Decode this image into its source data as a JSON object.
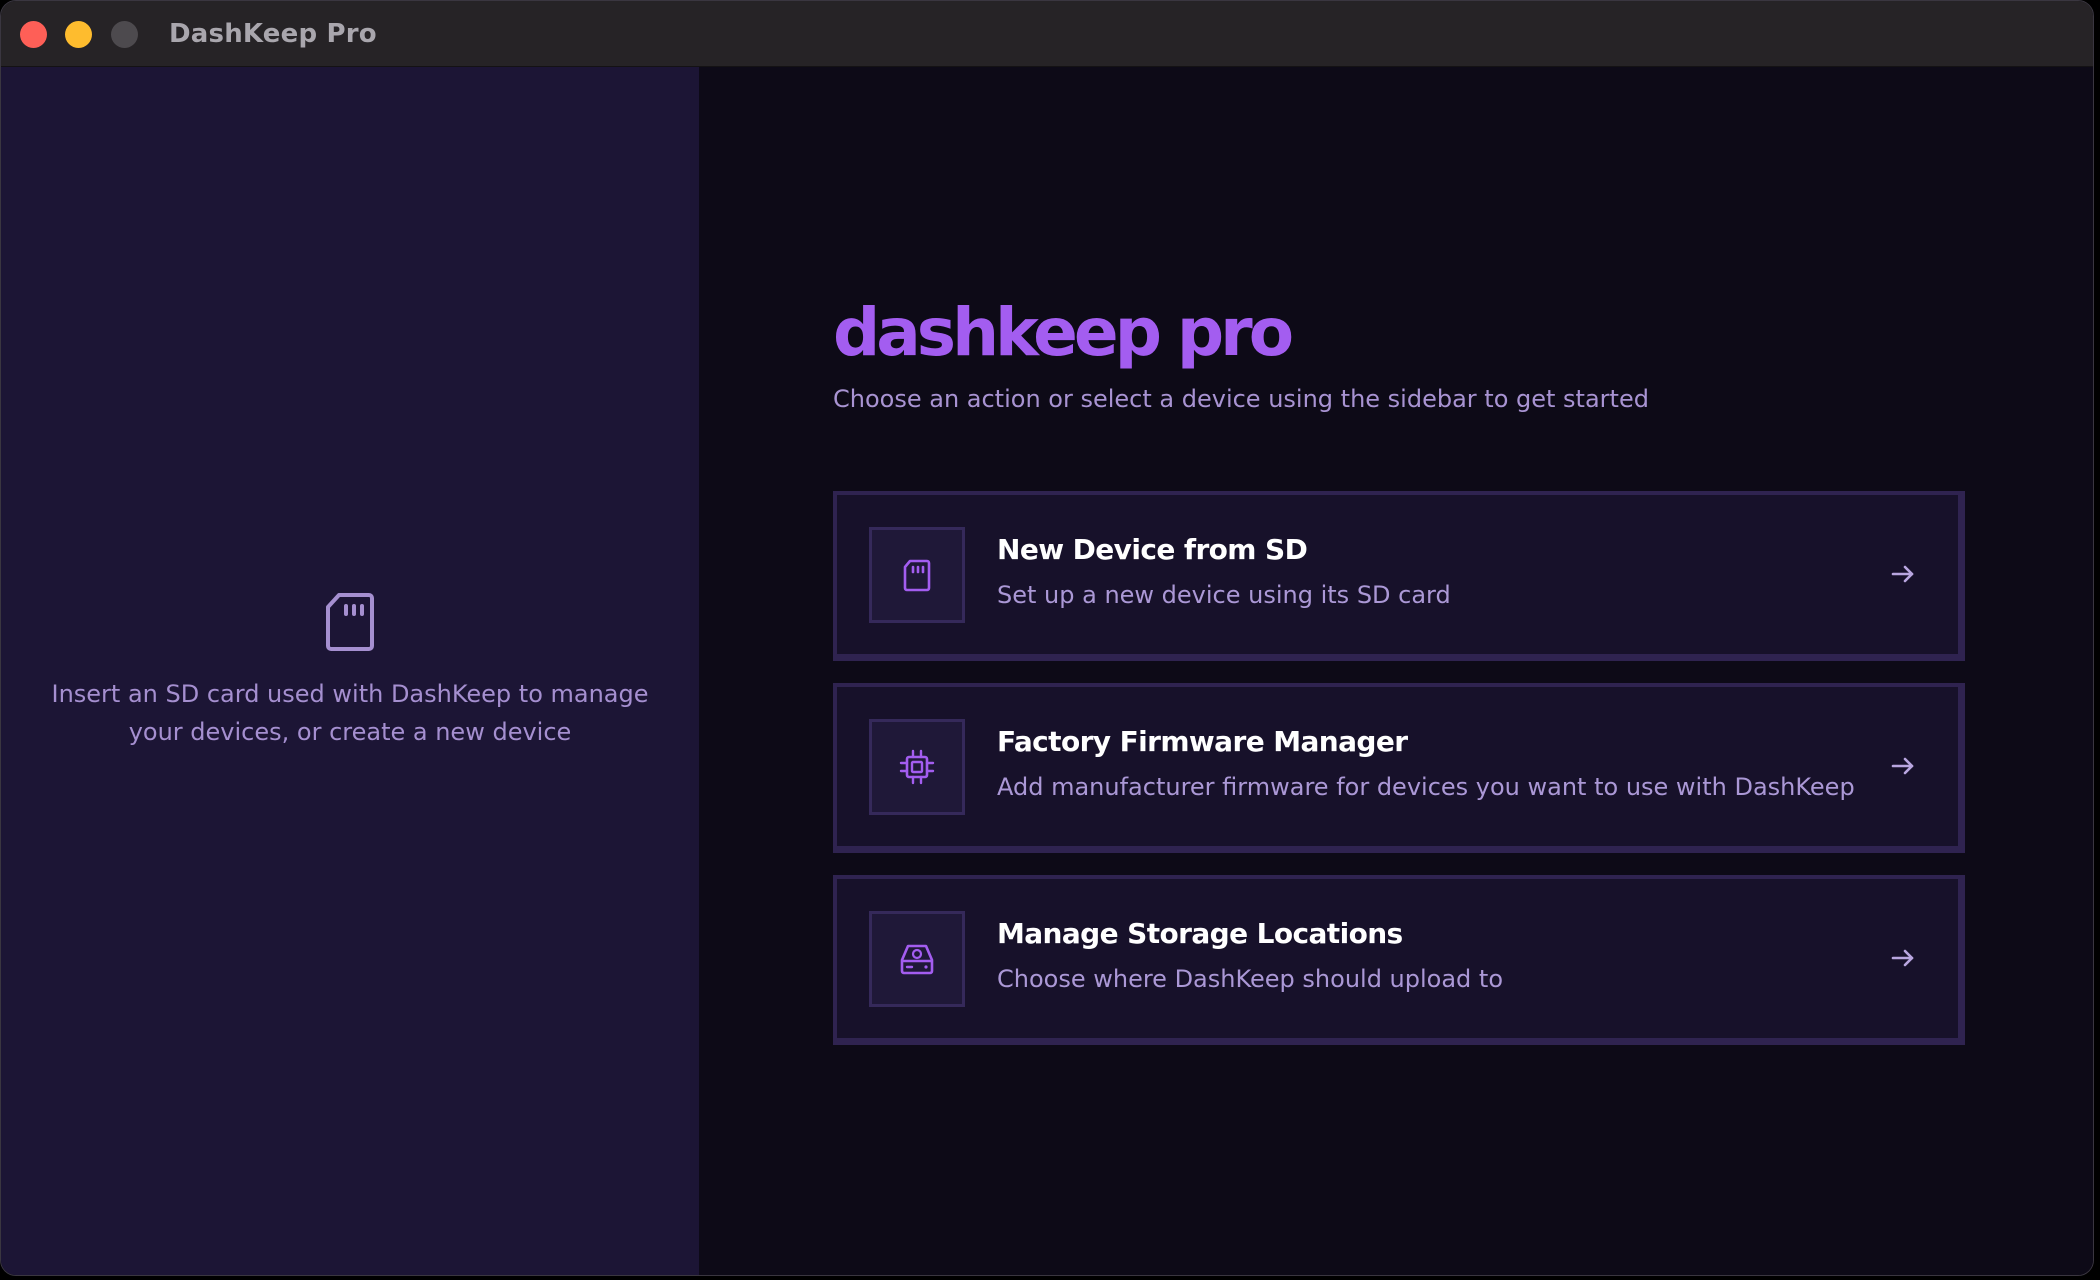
{
  "window": {
    "title": "DashKeep Pro"
  },
  "sidebar": {
    "empty_icon": "sd-card-icon",
    "message": "Insert an SD card used with DashKeep to manage your devices, or create a new device"
  },
  "main": {
    "brand": "dashkeep pro",
    "subtitle": "Choose an action or select a device using the sidebar to get started",
    "actions": [
      {
        "icon": "sd-card-icon",
        "title": "New Device from SD",
        "description": "Set up a new device using its SD card"
      },
      {
        "icon": "chip-icon",
        "title": "Factory Firmware Manager",
        "description": "Add manufacturer firmware for devices you want to use with DashKeep"
      },
      {
        "icon": "hard-drive-icon",
        "title": "Manage Storage Locations",
        "description": "Choose where DashKeep should upload to"
      }
    ]
  },
  "colors": {
    "accent": "#a35df0",
    "sidebar_bg": "#1c1535",
    "main_bg": "#0d0a17",
    "card_bg": "#17112a",
    "card_border": "#2f2350",
    "muted_text": "#a893d2"
  }
}
